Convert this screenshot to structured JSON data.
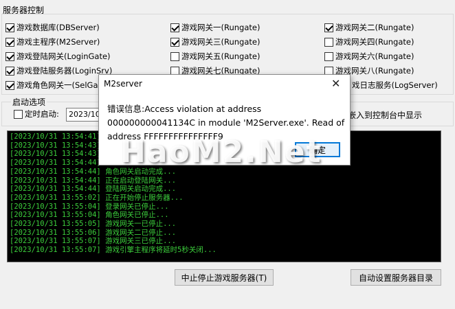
{
  "server_control": {
    "title": "服务器控制",
    "checkboxes": [
      {
        "label": "游戏数据库(DBServer)",
        "checked": true
      },
      {
        "label": "游戏网关一(Rungate)",
        "checked": true
      },
      {
        "label": "游戏网关二(Rungate)",
        "checked": true
      },
      {
        "label": "游戏主程序(M2Server)",
        "checked": true
      },
      {
        "label": "游戏网关三(Rungate)",
        "checked": true
      },
      {
        "label": "游戏网关四(Rungate)",
        "checked": false
      },
      {
        "label": "游戏登陆网关(LoginGate)",
        "checked": true
      },
      {
        "label": "游戏网关五(Rungate)",
        "checked": false
      },
      {
        "label": "游戏网关六(Rungate)",
        "checked": false
      },
      {
        "label": "游戏登陆服务器(LoginSrv)",
        "checked": true
      },
      {
        "label": "游戏网关七(Rungate)",
        "checked": false
      },
      {
        "label": "游戏网关八(Rungate)",
        "checked": false
      },
      {
        "label": "游戏角色网关一(SelGa",
        "checked": true
      },
      {
        "label": "戏日志服务(LogServer)",
        "checked": true
      }
    ]
  },
  "startup": {
    "title": "启动选项",
    "timed_start_label": "定时启动:",
    "date_value": "2023/10/",
    "embed_label": "嵌入到控制台中显示"
  },
  "log": {
    "lines": [
      "[2023/10/31 13:54:41]",
      "[2023/10/31 13:54:43]",
      "[2023/10/31 13:54:43]",
      "[2023/10/31 13:54:44]",
      "[2023/10/31 13:54:44] 角色网关启动完成...",
      "[2023/10/31 13:54:44] 正在启动登陆网关...",
      "[2023/10/31 13:54:44] 登陆网关启动完成...",
      "[2023/10/31 13:55:02] 正在开始停止服务器...",
      "[2023/10/31 13:55:04] 登录网关已停止...",
      "[2023/10/31 13:55:04] 角色网关已停止...",
      "[2023/10/31 13:55:05] 游戏网关一已停止...",
      "[2023/10/31 13:55:06] 游戏网关二已停止...",
      "[2023/10/31 13:55:07] 游戏网关三已停止...",
      "[2023/10/31 13:55:07] 游戏引擎主程序将延时5秒关闭..."
    ]
  },
  "buttons": {
    "stop_server": "中止停止游戏服务器(T)",
    "auto_dir": "自动设置服务器目录"
  },
  "dialog": {
    "title": "M2server",
    "close": "✕",
    "message": "错误信息:Access violation at address 000000000041134C in module 'M2Server.exe'. Read of address FFFFFFFFFFFFFFF9",
    "ok_label": "确定"
  },
  "watermark": "HaoM2.Net"
}
